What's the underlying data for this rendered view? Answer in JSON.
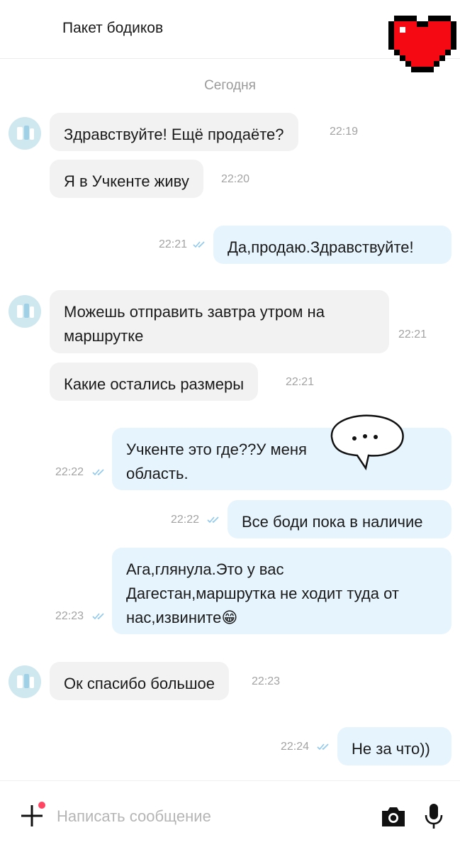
{
  "header": {
    "title": "Пакет бодиков"
  },
  "date_separator": "Сегодня",
  "messages": [
    {
      "side": "in",
      "text": "Здравствуйте! Ещё продаёте?",
      "time": "22:19"
    },
    {
      "side": "in",
      "text": "Я в Учкенте живу",
      "time": "22:20"
    },
    {
      "side": "out",
      "text": "Да,продаю.Здравствуйте!",
      "time": "22:21"
    },
    {
      "side": "in",
      "lines": [
        "Можешь отправить завтра утром на",
        "маршрутке"
      ],
      "time": "22:21"
    },
    {
      "side": "in",
      "text": "Какие остались размеры",
      "time": "22:21"
    },
    {
      "side": "out",
      "lines": [
        "Учкенте это где??У меня",
        "область."
      ],
      "time": "22:22"
    },
    {
      "side": "out",
      "text": "Все боди пока в наличие",
      "time": "22:22"
    },
    {
      "side": "out",
      "lines": [
        "Ага,глянула.Это у вас",
        "Дагестан,маршрутка не ходит туда от",
        "нас,извините😁"
      ],
      "time": "22:23"
    },
    {
      "side": "in",
      "text": "Ок спасибо большое",
      "time": "22:23"
    },
    {
      "side": "out",
      "text": "Не за что))",
      "time": "22:24"
    }
  ],
  "composer": {
    "placeholder": "Написать сообщение"
  },
  "icons": {
    "attach": "plus-icon",
    "camera": "camera-icon",
    "mic": "microphone-icon",
    "read_receipt": "double-check-icon"
  },
  "colors": {
    "incoming_bubble": "#f2f2f2",
    "outgoing_bubble": "#e6f4fd",
    "notification_dot": "#ff4561",
    "read_check": "#8fc9ee"
  }
}
